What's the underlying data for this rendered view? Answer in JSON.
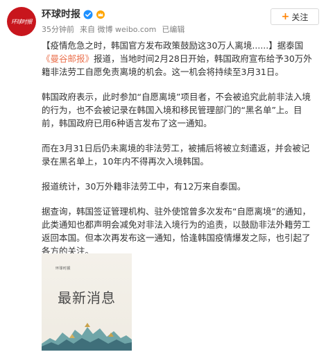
{
  "header": {
    "avatar_text": "环球时报",
    "user_name": "环球时报",
    "time_ago": "35分钟前",
    "source_prefix": "来自",
    "source": "微博 weibo.com",
    "edited": "已编辑",
    "follow_label": "关注",
    "verified_icon": "verified-badge-icon",
    "accent_color": "#ff8200",
    "link_color": "#eb7350"
  },
  "post": {
    "p1_lead": "【疫情危急之时，韩国官方发布政策鼓励这30万人离境......】据泰国",
    "p1_link": "《曼谷邮报》",
    "p1_tail": "报道，当地时间2月28日开始，韩国政府宣布给予30万外籍非法劳工自愿免责离境的机会。这一机会将持续至3月31日。",
    "p2": "韩国政府表示，此时参加“自愿离境”项目者，不会被追究此前非法入境的行为，也不会被记录在韩国入境和移民管理部门的“黑名单”上。目前，韩国政府已用6种语言发布了这一通知。",
    "p3": "而在3月31日后仍未离境的非法劳工，被捕后将被立刻遣返，并会被记录在黑名单上，10年内不得再次入境韩国。",
    "p4": "报道统计，30万外籍非法劳工中，有12万来自泰国。",
    "p5": "据查询，韩国签证管理机构、驻外使馆曾多次发布“自愿离境”的通知，此类通知也都声明会减免对非法入境行为的追责，以鼓励非法外籍劳工返回本国。但本次再发布这一通知，恰逢韩国疫情爆发之际，也引起了各方的关注。"
  },
  "image": {
    "brand": "环球时报",
    "title": "最新消息"
  }
}
